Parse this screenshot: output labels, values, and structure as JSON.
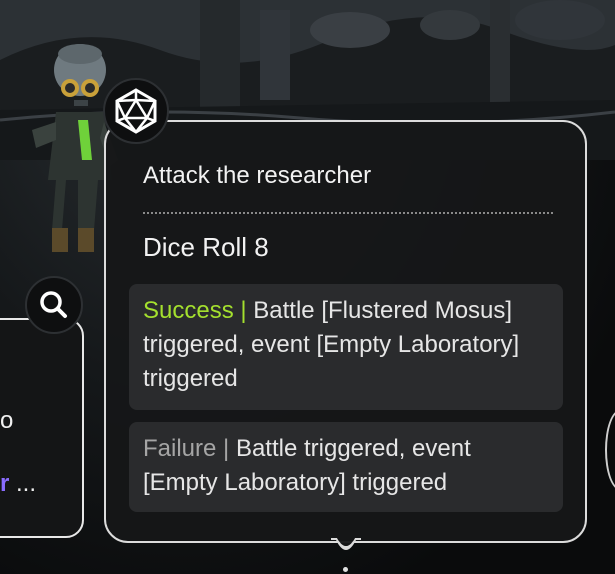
{
  "popup": {
    "title": "Attack the researcher",
    "dice_roll": "Dice Roll 8",
    "outcomes": [
      {
        "tag": "Success",
        "separator": "|",
        "text": "Battle [Flustered Mosus] triggered, event [Empty Laboratory] triggered",
        "tag_color": "#a4e02e"
      },
      {
        "tag": "Failure",
        "separator": "|",
        "text": "Battle triggered, event [Empty Laboratory] triggered",
        "tag_color": "#a5a5a5"
      }
    ]
  },
  "left_card": {
    "partial_letter": "o",
    "trail_highlight": "r",
    "trail_ellipsis": "..."
  },
  "icons": {
    "search": "search-icon",
    "dice": "d20-dice-icon"
  },
  "colors": {
    "success": "#a4e02e",
    "failure": "#a5a5a5",
    "accent_purple": "#8a6cff"
  }
}
